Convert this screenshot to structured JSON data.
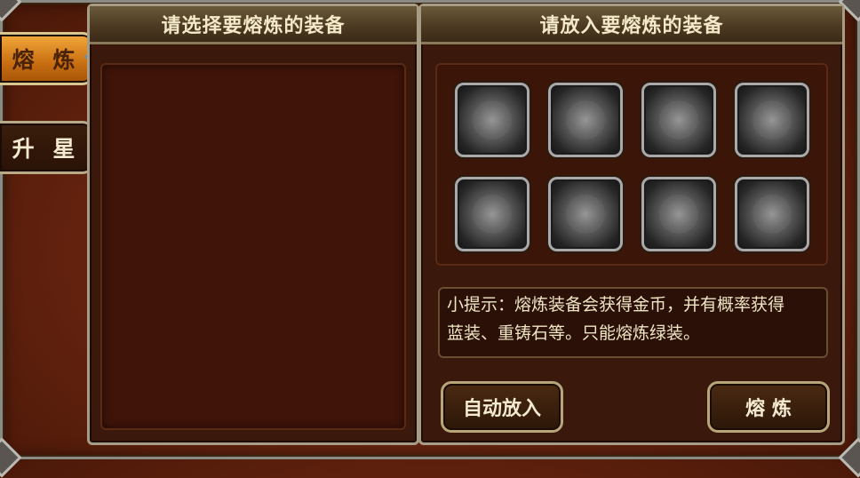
{
  "tabs": [
    {
      "label": "熔 炼",
      "active": true
    },
    {
      "label": "升 星",
      "active": false
    }
  ],
  "left_panel": {
    "title": "请选择要熔炼的装备"
  },
  "right_panel": {
    "title": "请放入要熔炼的装备",
    "slots": [
      "empty-slot",
      "empty-slot",
      "empty-slot",
      "empty-slot",
      "empty-slot",
      "empty-slot",
      "empty-slot",
      "empty-slot"
    ],
    "tip_line1": "小提示：熔炼装备会获得金币，并有概率获得",
    "tip_line2": "蓝装、重铸石等。只能熔炼绿装。",
    "auto_button": "自动放入",
    "smelt_button": "熔 炼"
  },
  "colors": {
    "active_tab": "#e08a24",
    "panel_bg": "#3a180c",
    "text": "#f3ead0"
  }
}
